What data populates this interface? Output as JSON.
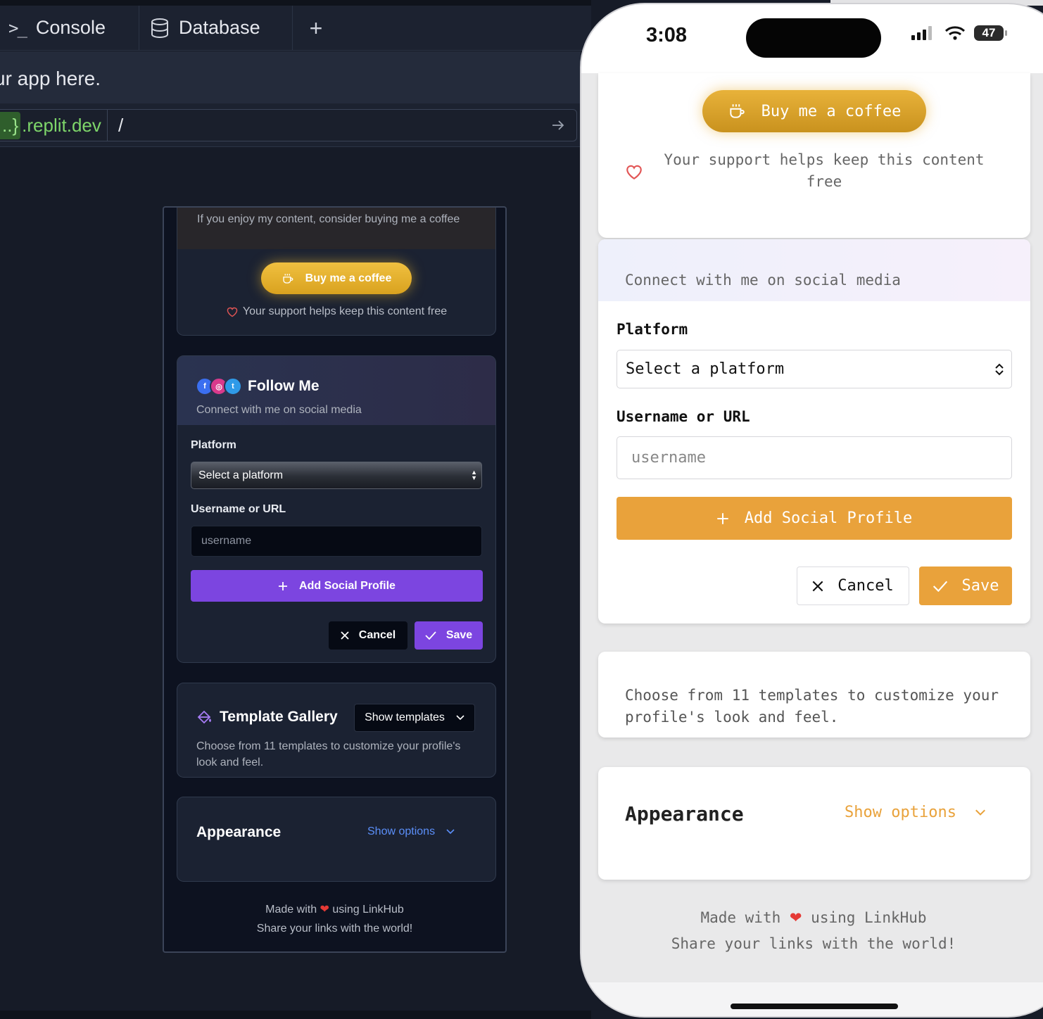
{
  "workspace": {
    "tabs": [
      {
        "label": "Console",
        "icon": "terminal-icon"
      },
      {
        "label": "Database",
        "icon": "database-icon"
      }
    ],
    "add_tab": "+",
    "hint_text": "ur app here.",
    "url": {
      "domain_prefix": "..}",
      "domain_suffix": ".replit.dev",
      "path": "/"
    }
  },
  "preview": {
    "coffee": {
      "description": "If you enjoy my content, consider buying me a coffee",
      "button": "Buy me a coffee",
      "support": "Your support helps keep this content free"
    },
    "follow": {
      "title": "Follow Me",
      "subtitle": "Connect with me on social media",
      "platform_label": "Platform",
      "platform_value": "Select a platform",
      "username_label": "Username or URL",
      "username_placeholder": "username",
      "add_button": "Add Social Profile",
      "cancel_button": "Cancel",
      "save_button": "Save"
    },
    "template": {
      "title": "Template Gallery",
      "button": "Show templates",
      "description": "Choose from 11 templates to customize your profile's look and feel."
    },
    "appearance": {
      "title": "Appearance",
      "button": "Show options"
    },
    "footer": {
      "made_with_prefix": "Made with",
      "made_with_suffix": "using LinkHub",
      "tagline": "Share your links with the world!"
    }
  },
  "phone": {
    "time": "3:08",
    "battery": "47",
    "coffee": {
      "button": "Buy me a coffee",
      "support": "Your support helps keep this content free"
    },
    "follow": {
      "subtitle": "Connect with me on social media",
      "platform_label": "Platform",
      "platform_value": "Select a platform",
      "username_label": "Username or URL",
      "username_placeholder": "username",
      "add_button": "Add Social Profile",
      "cancel_button": "Cancel",
      "save_button": "Save"
    },
    "template": {
      "description": "Choose from 11 templates to customize your profile's look and feel."
    },
    "appearance": {
      "title": "Appearance",
      "button": "Show options"
    },
    "footer": {
      "made_with_prefix": "Made with",
      "made_with_suffix": "using LinkHub",
      "tagline": "Share your links with the world!"
    }
  },
  "colors": {
    "accent_purple": "#7c45e0",
    "accent_orange": "#e9a23b",
    "link_blue": "#5b8ff9",
    "url_green": "#7ed66a"
  }
}
